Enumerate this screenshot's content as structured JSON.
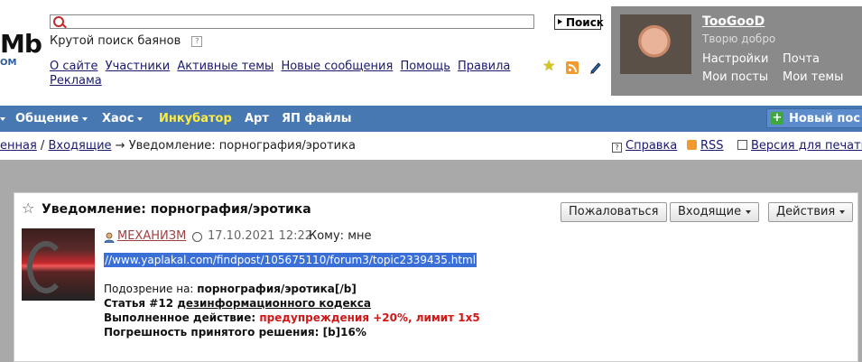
{
  "logo": {
    "big": "Mb",
    "sup": "b",
    "dom": "OM"
  },
  "search": {
    "value": "",
    "placeholder": "",
    "button": "Поиск",
    "tagline": "Крутой поиск баянов",
    "help_icon": "?"
  },
  "toplinks": [
    "О сайте",
    "Участники",
    "Активные темы",
    "Новые сообщения",
    "Помощь",
    "Правила",
    "Реклама"
  ],
  "user": {
    "name": "TooGooD",
    "title": "Творю добро",
    "links": [
      "Настройки",
      "Почта",
      "Мои посты",
      "Мои темы"
    ]
  },
  "nav": {
    "items": [
      "Общение",
      "Хаос",
      "Инкубатор",
      "Арт",
      "ЯП файлы"
    ],
    "new_post": "Новый пос"
  },
  "crumbs": {
    "first": "енная",
    "sep1": " / ",
    "second": "Входящие",
    "arrow": " → ",
    "current": "Уведомление: порнография/эротика"
  },
  "tools": {
    "help": "Справка",
    "rss": "RSS",
    "print": "Версия для печати"
  },
  "post": {
    "title": "Уведомление: порнография/эротика",
    "buttons": {
      "report": "Пожаловаться",
      "inbox": "Входящие",
      "actions": "Действия"
    },
    "author": "МЕХАНИЗМ",
    "date": "17.10.2021 12:22",
    "to": "Кому: мне",
    "link": "//www.yaplakal.com/findpost/105675110/forum3/topic2339435.html",
    "suspect_label": "Подозрение на: ",
    "suspect_value": "порнография/эротика[/b]",
    "article_prefix": "Статья #12 ",
    "article_link": "дезинформационного кодекса",
    "action_label": "Выполненное действие: ",
    "action_value": "предупреждения +20%, лимит 1х5",
    "error_label": "Погрешность принятого решения: ",
    "error_value": "[b]16%"
  },
  "colors": {
    "nav_bg": "#4778b2",
    "user_panel": "#8a8a8a",
    "highlight": "#3a6fd8",
    "warning_red": "#d01818",
    "incubator_yellow": "#ffec3d"
  },
  "icons": [
    "search-icon",
    "star-icon",
    "rss-icon",
    "pen-icon",
    "plus-icon",
    "help-icon",
    "print-icon",
    "user-icon",
    "clock-icon"
  ]
}
